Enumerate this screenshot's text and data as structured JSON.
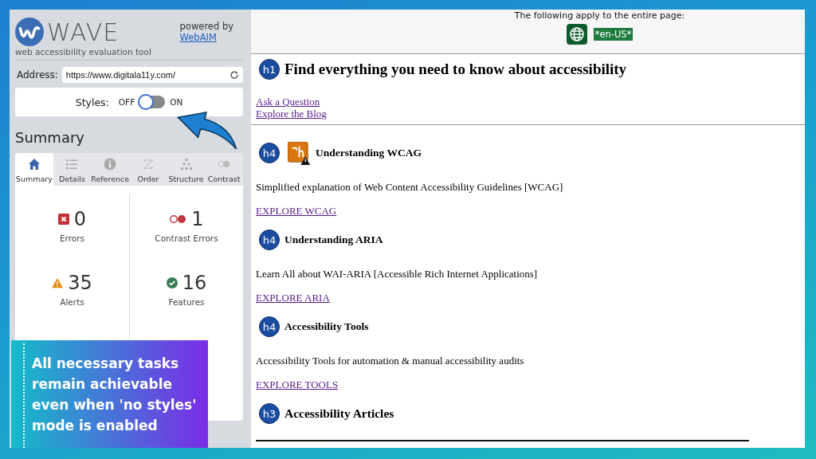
{
  "panel": {
    "logo": "WAVE",
    "tagline": "web accessibility evaluation tool",
    "powered_by": "powered by",
    "powered_link": "WebAIM",
    "address": {
      "label": "Address:",
      "value": "https://www.digitala11y.com/"
    },
    "styles": {
      "label": "Styles:",
      "off_label": "OFF",
      "on_label": "ON",
      "on": false
    },
    "summary_title": "Summary",
    "tabs": [
      {
        "label": "Summary",
        "selected": true
      },
      {
        "label": "Details",
        "selected": false
      },
      {
        "label": "Reference",
        "selected": false
      },
      {
        "label": "Order",
        "selected": false
      },
      {
        "label": "Structure",
        "selected": false
      },
      {
        "label": "Contrast",
        "selected": false
      }
    ],
    "stats": [
      {
        "kind": "error",
        "count": "0",
        "label": "Errors"
      },
      {
        "kind": "contrast",
        "count": "1",
        "label": "Contrast Errors"
      },
      {
        "kind": "alert",
        "count": "35",
        "label": "Alerts"
      },
      {
        "kind": "feature",
        "count": "16",
        "label": "Features"
      }
    ]
  },
  "callout": {
    "text": "All necessary tasks remain achievable even when 'no styles' mode is enabled"
  },
  "page": {
    "notice": "The following apply to the entire page:",
    "language": "*en-US*",
    "blocks": [
      {
        "kind": "title",
        "badge": "h1",
        "text": "Find everything you need to know about accessibility",
        "alert": false
      },
      {
        "kind": "links",
        "items": [
          "Ask a Question",
          "Explore the Blog"
        ]
      },
      {
        "kind": "rule"
      },
      {
        "kind": "heading",
        "badge": "h4",
        "text": "Understanding WCAG",
        "alert": true
      },
      {
        "kind": "paragraph",
        "text": "Simplified explanation of Web Content Accessibility Guidelines [WCAG]"
      },
      {
        "kind": "links",
        "items": [
          "EXPLORE WCAG"
        ]
      },
      {
        "kind": "heading",
        "badge": "h4",
        "text": "Understanding ARIA",
        "alert": false
      },
      {
        "kind": "paragraph",
        "text": "Learn All about WAI-ARIA [Accessible Rich Internet Applications]"
      },
      {
        "kind": "links",
        "items": [
          "EXPLORE ARIA"
        ]
      },
      {
        "kind": "heading",
        "badge": "h4",
        "text": "Accessibility Tools",
        "alert": false
      },
      {
        "kind": "paragraph",
        "text": "Accessibility Tools for automation & manual accessibility audits"
      },
      {
        "kind": "links",
        "items": [
          "EXPLORE TOOLS"
        ]
      },
      {
        "kind": "section",
        "badge": "h3",
        "text": "Accessibility Articles",
        "alert": false
      }
    ]
  }
}
